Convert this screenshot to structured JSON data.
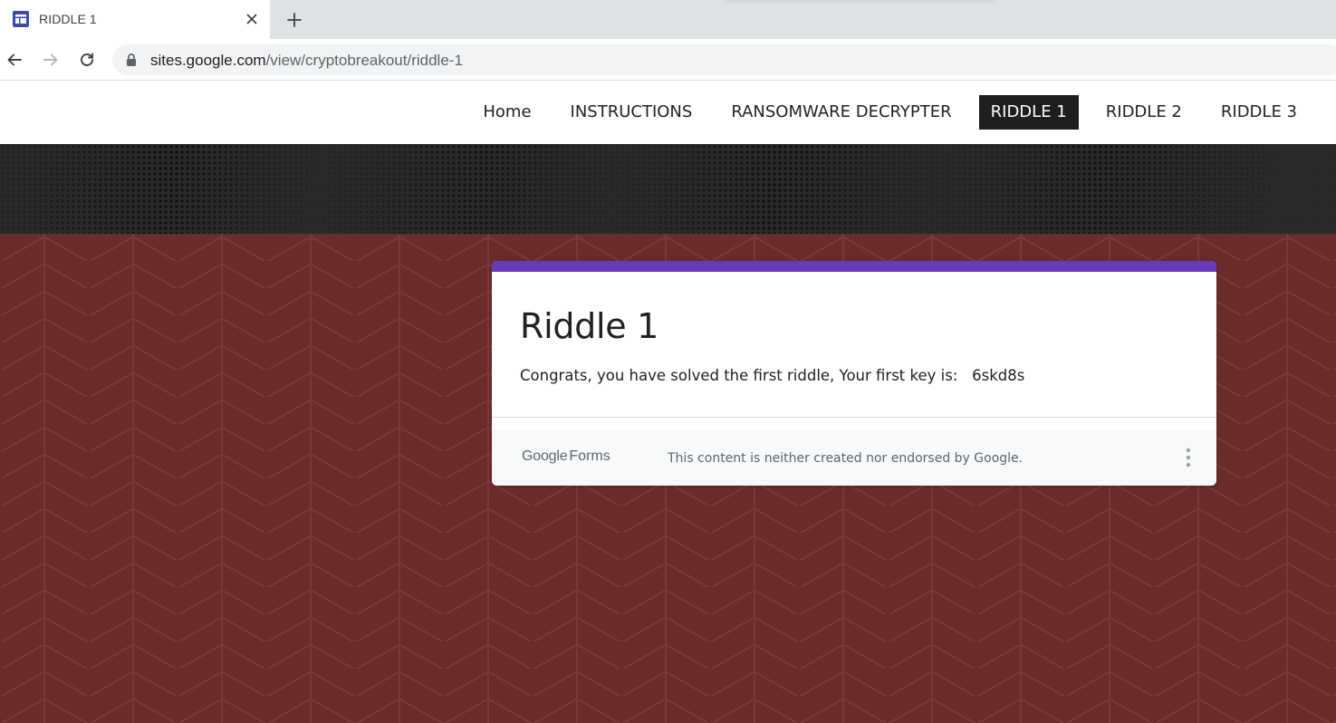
{
  "browser": {
    "tab": {
      "title": "RIDDLE 1",
      "favicon": "google-sites-icon"
    },
    "new_tab_icon": "plus-icon",
    "close_icon": "close-icon",
    "nav": {
      "back": "back-arrow-icon",
      "forward": "forward-arrow-icon",
      "reload": "reload-icon"
    },
    "address": {
      "domain": "sites.google.com",
      "path": "/view/cryptobreakout/riddle-1",
      "lock_icon": "lock-icon"
    }
  },
  "site": {
    "nav": [
      {
        "label": "Home",
        "active": false
      },
      {
        "label": "INSTRUCTIONS",
        "active": false
      },
      {
        "label": "RANSOMWARE DECRYPTER",
        "active": false
      },
      {
        "label": "RIDDLE 1",
        "active": true
      },
      {
        "label": "RIDDLE 2",
        "active": false
      },
      {
        "label": "RIDDLE 3",
        "active": false
      }
    ]
  },
  "form": {
    "title": "Riddle 1",
    "message": "Congrats, you have solved the first riddle, Your first key is:   6skd8s",
    "footer": {
      "logo_google": "Google",
      "logo_forms": "Forms",
      "disclaimer": "This content is neither created nor endorsed by Google.",
      "menu_icon": "more-vert-icon"
    }
  },
  "colors": {
    "form_accent": "#673ab7",
    "background": "#6b2a2b",
    "banner": "#2a2a2a",
    "active_nav_bg": "#1e1e1e"
  }
}
